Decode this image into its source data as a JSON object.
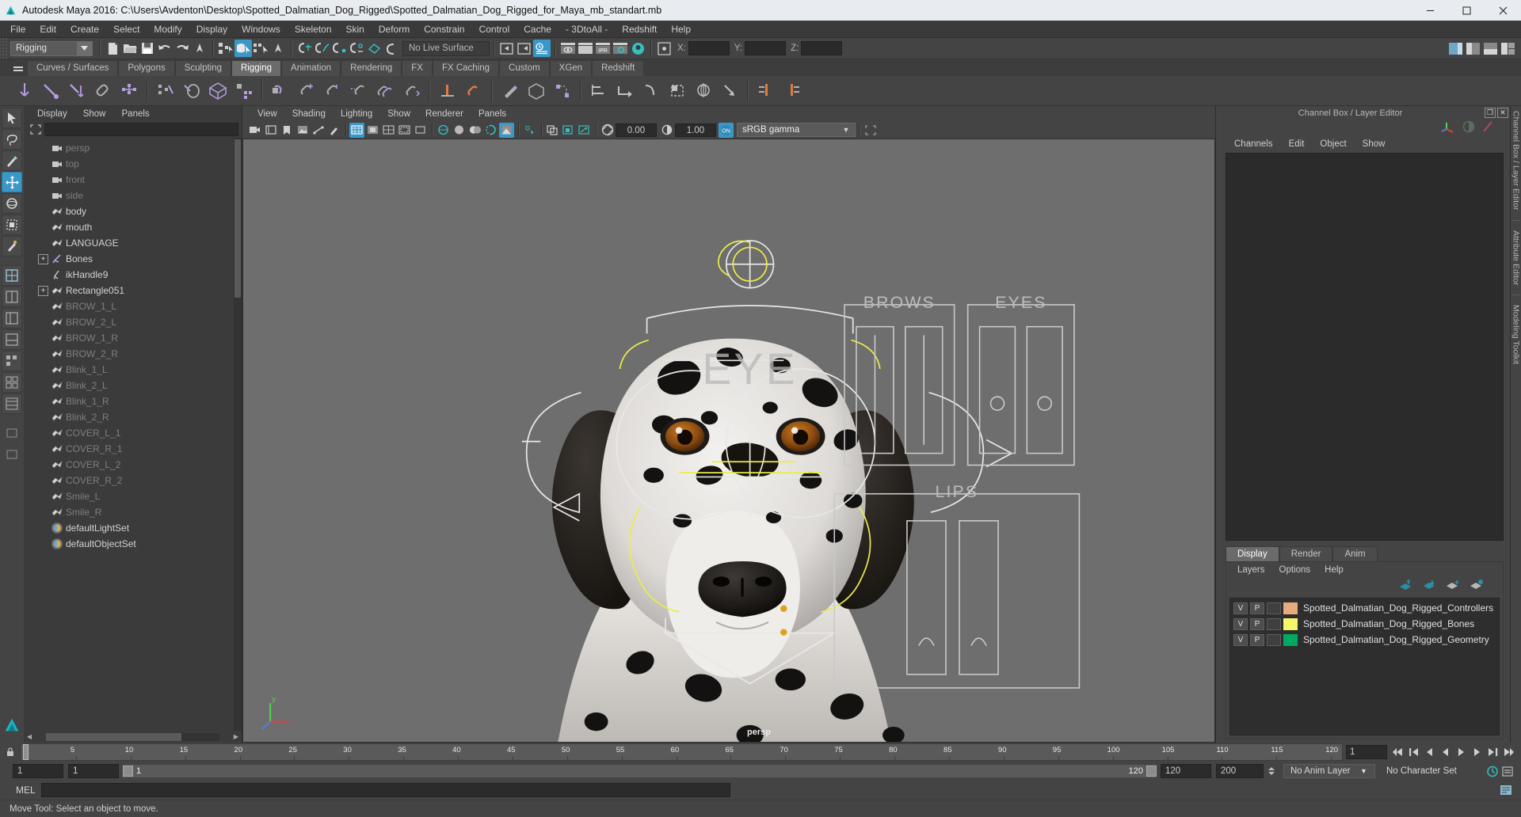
{
  "window": {
    "title": "Autodesk Maya 2016: C:\\Users\\Avdenton\\Desktop\\Spotted_Dalmatian_Dog_Rigged\\Spotted_Dalmatian_Dog_Rigged_for_Maya_mb_standart.mb",
    "minimize": "minimize-button",
    "maximize": "maximize-button",
    "close": "close-button"
  },
  "menubar": {
    "items": [
      "File",
      "Edit",
      "Create",
      "Select",
      "Modify",
      "Display",
      "Windows",
      "Skeleton",
      "Skin",
      "Deform",
      "Constrain",
      "Control",
      "Cache",
      "- 3DtoAll -",
      "Redshift",
      "Help"
    ]
  },
  "statusline": {
    "menu_set": "Rigging",
    "live_surface": "No Live Surface",
    "coord_labels": [
      "X:",
      "Y:",
      "Z:"
    ],
    "coord_values": [
      "",
      "",
      ""
    ]
  },
  "shelf": {
    "tabs": [
      "Curves / Surfaces",
      "Polygons",
      "Sculpting",
      "Rigging",
      "Animation",
      "Rendering",
      "FX",
      "FX Caching",
      "Custom",
      "XGen",
      "Redshift"
    ],
    "active_tab": "Rigging"
  },
  "outliner": {
    "menus": [
      "Display",
      "Show",
      "Panels"
    ],
    "search_value": "",
    "items": [
      {
        "label": "persp",
        "icon": "camera-icon",
        "dim": true,
        "expand": false,
        "indent": 1
      },
      {
        "label": "top",
        "icon": "camera-icon",
        "dim": true,
        "expand": false,
        "indent": 1
      },
      {
        "label": "front",
        "icon": "camera-icon",
        "dim": true,
        "expand": false,
        "indent": 1
      },
      {
        "label": "side",
        "icon": "camera-icon",
        "dim": true,
        "expand": false,
        "indent": 1
      },
      {
        "label": "body",
        "icon": "mesh-icon",
        "dim": false,
        "expand": false,
        "indent": 1
      },
      {
        "label": "mouth",
        "icon": "mesh-icon",
        "dim": false,
        "expand": false,
        "indent": 1
      },
      {
        "label": "LANGUAGE",
        "icon": "mesh-icon",
        "dim": false,
        "expand": false,
        "indent": 1
      },
      {
        "label": "Bones",
        "icon": "joint-icon",
        "dim": false,
        "expand": true,
        "indent": 1
      },
      {
        "label": "ikHandle9",
        "icon": "ikhandle-icon",
        "dim": false,
        "expand": false,
        "indent": 1
      },
      {
        "label": "Rectangle051",
        "icon": "mesh-icon",
        "dim": false,
        "expand": true,
        "indent": 1
      },
      {
        "label": "BROW_1_L",
        "icon": "mesh-icon",
        "dim": true,
        "expand": false,
        "indent": 1
      },
      {
        "label": "BROW_2_L",
        "icon": "mesh-icon",
        "dim": true,
        "expand": false,
        "indent": 1
      },
      {
        "label": "BROW_1_R",
        "icon": "mesh-icon",
        "dim": true,
        "expand": false,
        "indent": 1
      },
      {
        "label": "BROW_2_R",
        "icon": "mesh-icon",
        "dim": true,
        "expand": false,
        "indent": 1
      },
      {
        "label": "Blink_1_L",
        "icon": "mesh-icon",
        "dim": true,
        "expand": false,
        "indent": 1
      },
      {
        "label": "Blink_2_L",
        "icon": "mesh-icon",
        "dim": true,
        "expand": false,
        "indent": 1
      },
      {
        "label": "Blink_1_R",
        "icon": "mesh-icon",
        "dim": true,
        "expand": false,
        "indent": 1
      },
      {
        "label": "Blink_2_R",
        "icon": "mesh-icon",
        "dim": true,
        "expand": false,
        "indent": 1
      },
      {
        "label": "COVER_L_1",
        "icon": "mesh-icon",
        "dim": true,
        "expand": false,
        "indent": 1
      },
      {
        "label": "COVER_R_1",
        "icon": "mesh-icon",
        "dim": true,
        "expand": false,
        "indent": 1
      },
      {
        "label": "COVER_L_2",
        "icon": "mesh-icon",
        "dim": true,
        "expand": false,
        "indent": 1
      },
      {
        "label": "COVER_R_2",
        "icon": "mesh-icon",
        "dim": true,
        "expand": false,
        "indent": 1
      },
      {
        "label": "Smile_L",
        "icon": "mesh-icon",
        "dim": true,
        "expand": false,
        "indent": 1
      },
      {
        "label": "Smile_R",
        "icon": "mesh-icon",
        "dim": true,
        "expand": false,
        "indent": 1
      },
      {
        "label": "defaultLightSet",
        "icon": "set-icon",
        "dim": false,
        "expand": false,
        "indent": 1
      },
      {
        "label": "defaultObjectSet",
        "icon": "set-icon",
        "dim": false,
        "expand": false,
        "indent": 1
      }
    ]
  },
  "viewport": {
    "menus": [
      "View",
      "Shading",
      "Lighting",
      "Show",
      "Renderer",
      "Panels"
    ],
    "exposure": "0.00",
    "gamma_value": "1.00",
    "color_profile": "sRGB gamma",
    "camera_label": "persp",
    "rig_labels": [
      "EYE",
      "BROWS",
      "EYES",
      "LIPS"
    ]
  },
  "channelbox": {
    "panel_title": "Channel Box / Layer Editor",
    "menus": [
      "Channels",
      "Edit",
      "Object",
      "Show"
    ]
  },
  "layers": {
    "tabs": [
      "Display",
      "Render",
      "Anim"
    ],
    "active_tab": "Display",
    "menus": [
      "Layers",
      "Options",
      "Help"
    ],
    "rows": [
      {
        "v": "V",
        "p": "P",
        "color": "#e8ab7e",
        "name": "Spotted_Dalmatian_Dog_Rigged_Controllers"
      },
      {
        "v": "V",
        "p": "P",
        "color": "#f7f76a",
        "name": "Spotted_Dalmatian_Dog_Rigged_Bones"
      },
      {
        "v": "V",
        "p": "P",
        "color": "#00a861",
        "name": "Spotted_Dalmatian_Dog_Rigged_Geometry"
      }
    ]
  },
  "rail": {
    "labels": [
      "Channel Box / Layer Editor",
      "Attribute Editor",
      "Modeling Toolkit"
    ]
  },
  "timeline": {
    "ticks": [
      "5",
      "10",
      "15",
      "20",
      "25",
      "30",
      "35",
      "40",
      "45",
      "50",
      "55",
      "60",
      "65",
      "70",
      "75",
      "80",
      "85",
      "90",
      "95",
      "100",
      "105",
      "110",
      "115",
      "120"
    ],
    "current_frame": "1",
    "range_start": "1",
    "range_end": "1",
    "playback_start": "1",
    "playback_end": "120",
    "anim_start": "120",
    "anim_end": "200",
    "anim_layer": "No Anim Layer",
    "character_set": "No Character Set",
    "slider_label": "1",
    "slider_end_label": "120"
  },
  "command": {
    "prompt": "MEL",
    "value": ""
  },
  "status": {
    "help_text": "Move Tool: Select an object to move."
  },
  "colors": {
    "accent": "#3a98c8",
    "viewport_bg": "#6e6e6e",
    "panel_bg": "#444444"
  }
}
